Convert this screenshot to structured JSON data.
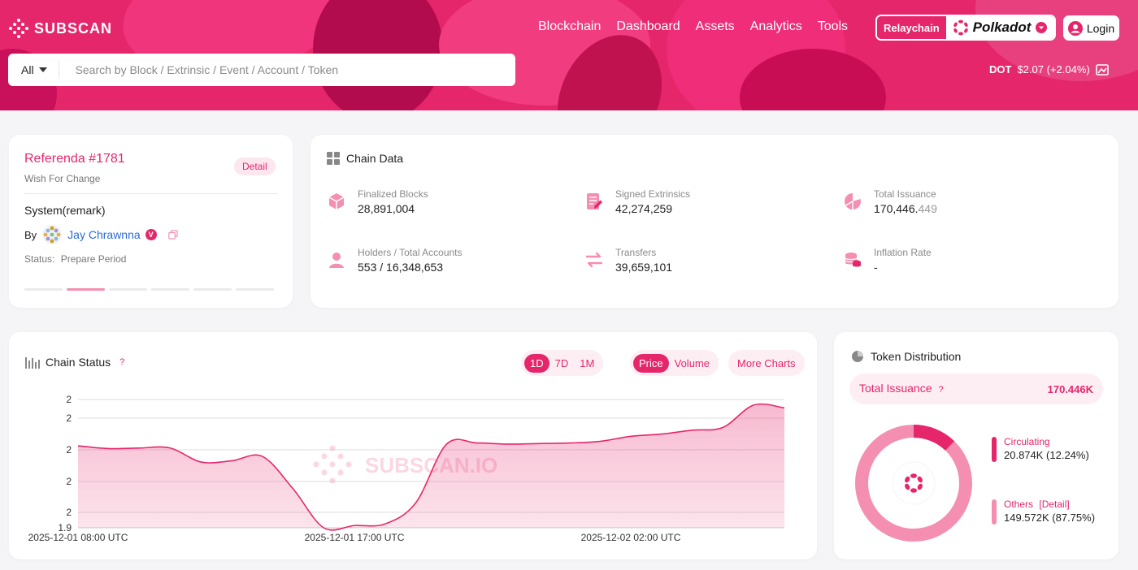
{
  "header": {
    "logo_text": "SUBSCAN",
    "nav": [
      "Blockchain",
      "Dashboard",
      "Assets",
      "Analytics",
      "Tools"
    ],
    "relay_label": "Relaychain",
    "network_name": "Polkadot",
    "login_label": "Login",
    "search": {
      "scope": "All",
      "placeholder": "Search by Block / Extrinsic / Event / Account / Token"
    },
    "price": {
      "symbol": "DOT",
      "value": "$2.07 (+2.04%)"
    }
  },
  "referenda": {
    "title": "Referenda #1781",
    "subtitle": "Wish For Change",
    "detail_label": "Detail",
    "method": "System(remark)",
    "by_label": "By",
    "author": "Jay Chrawnna",
    "verified_badge": "V",
    "status_label": "Status:",
    "status_value": "Prepare Period",
    "progress": {
      "steps": 6,
      "active_index": 1
    }
  },
  "chain_data": {
    "title": "Chain Data",
    "metrics": [
      {
        "label": "Finalized Blocks",
        "value": "28,891,004",
        "icon": "cube-icon"
      },
      {
        "label": "Signed Extrinsics",
        "value": "42,274,259",
        "icon": "document-icon"
      },
      {
        "label": "Total Issuance",
        "value_main": "170,446.",
        "value_dim": "449",
        "icon": "pie-icon"
      },
      {
        "label": "Holders / Total Accounts",
        "value": "553 / 16,348,653",
        "icon": "user-icon"
      },
      {
        "label": "Transfers",
        "value": "39,659,101",
        "icon": "transfer-icon"
      },
      {
        "label": "Inflation Rate",
        "value": "-",
        "icon": "coins-icon"
      }
    ]
  },
  "chain_status": {
    "title": "Chain Status",
    "help": "?",
    "ranges": [
      "1D",
      "7D",
      "1M"
    ],
    "active_range": "1D",
    "metrics": [
      "Price",
      "Volume"
    ],
    "active_metric": "Price",
    "more_label": "More Charts",
    "watermark": "SUBSCAN.IO"
  },
  "chart_data": {
    "type": "area",
    "y_tick_labels": [
      "2",
      "2",
      "2",
      "2",
      "2",
      "1.9"
    ],
    "x_tick_labels": [
      "2025-12-01 08:00 UTC",
      "2025-12-01 17:00 UTC",
      "2025-12-02 02:00 UTC"
    ],
    "x": [
      0,
      1,
      2,
      3,
      4,
      5,
      6,
      7,
      8,
      9,
      10,
      11,
      12,
      13,
      14,
      15,
      16,
      17,
      18,
      19,
      20,
      21,
      22,
      23
    ],
    "values": [
      2.047,
      2.042,
      2.043,
      2.043,
      2.018,
      2.02,
      2.028,
      1.97,
      1.9,
      1.904,
      1.907,
      1.945,
      2.05,
      2.052,
      2.05,
      2.051,
      2.052,
      2.055,
      2.064,
      2.068,
      2.075,
      2.08,
      2.12,
      2.115
    ],
    "ylim": [
      1.9,
      2.13
    ],
    "grid": true,
    "color": "#e6266b"
  },
  "token_distribution": {
    "title": "Token Distribution",
    "total_label": "Total Issuance",
    "help": "?",
    "total_value": "170.446K",
    "segments": [
      {
        "name": "Circulating",
        "value": "20.874K (12.24%)",
        "percent": 12.24,
        "color": "#e6266b"
      },
      {
        "name": "Others",
        "detail": "[Detail]",
        "value": "149.572K (87.75%)",
        "percent": 87.75,
        "color": "#f48fb1"
      }
    ]
  }
}
